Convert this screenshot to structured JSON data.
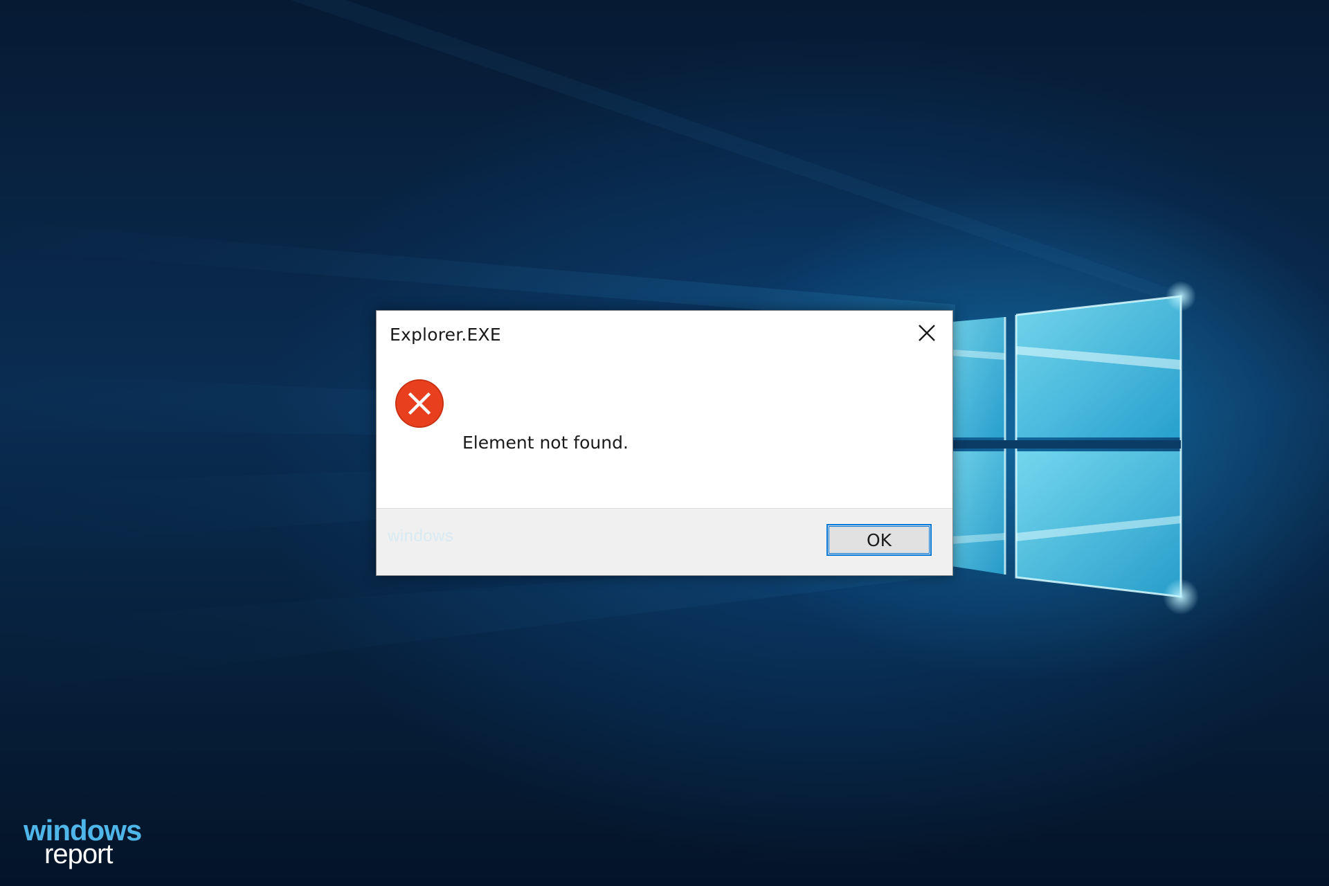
{
  "desktop": {
    "background_color": "#0a2d52",
    "accent_color": "#5fd3f0"
  },
  "dialog": {
    "title": "Explorer.EXE",
    "message": "Element not found.",
    "icon": "error-icon",
    "icon_color": "#e8401e",
    "ok_label": "OK",
    "ok_border_color": "#0078d7",
    "footer_watermark": "windows"
  },
  "brand": {
    "line1": "windows",
    "line2": "report"
  }
}
